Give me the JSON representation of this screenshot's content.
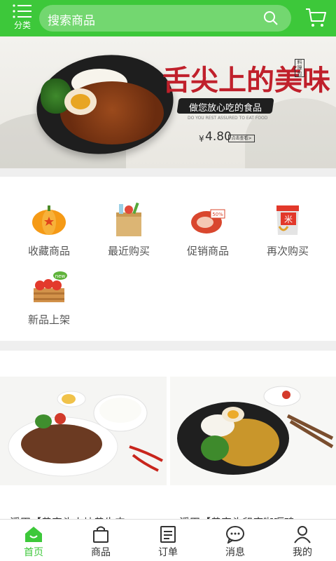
{
  "header": {
    "category_label": "分类",
    "search_placeholder": "搜索商品"
  },
  "banner": {
    "title": "舌尖上的美味",
    "stamp": "料理包",
    "subtitle": "做您放心吃的食品",
    "tagline": "DO YOU REST ASSURED TO EAT FOOD",
    "price_symbol": "¥",
    "price": "4.80",
    "view_button": "点击查看>",
    "slide_count": 2,
    "active_slide": 2
  },
  "quick_menu": [
    {
      "label": "收藏商品",
      "icon": "pumpkin-icon"
    },
    {
      "label": "最近购买",
      "icon": "grocery-bag-icon"
    },
    {
      "label": "促销商品",
      "icon": "meat-sale-icon"
    },
    {
      "label": "再次购买",
      "icon": "rice-bag-icon"
    },
    {
      "label": "新品上架",
      "icon": "new-tomato-crate-icon"
    }
  ],
  "products": [
    {
      "name": "溪田【黄家头小炒黄牛肉",
      "image": "beef-stir-fry-image"
    },
    {
      "name": "溪田【黄家头印度咖喱鸡",
      "image": "curry-chicken-rice-image"
    }
  ],
  "tabbar": [
    {
      "label": "首页",
      "icon": "home-icon",
      "active": true
    },
    {
      "label": "商品",
      "icon": "shopping-bag-icon",
      "active": false
    },
    {
      "label": "订单",
      "icon": "order-list-icon",
      "active": false
    },
    {
      "label": "消息",
      "icon": "message-icon",
      "active": false
    },
    {
      "label": "我的",
      "icon": "user-icon",
      "active": false
    }
  ],
  "colors": {
    "brand_green": "#3dc83a",
    "banner_red": "#c0202b"
  }
}
